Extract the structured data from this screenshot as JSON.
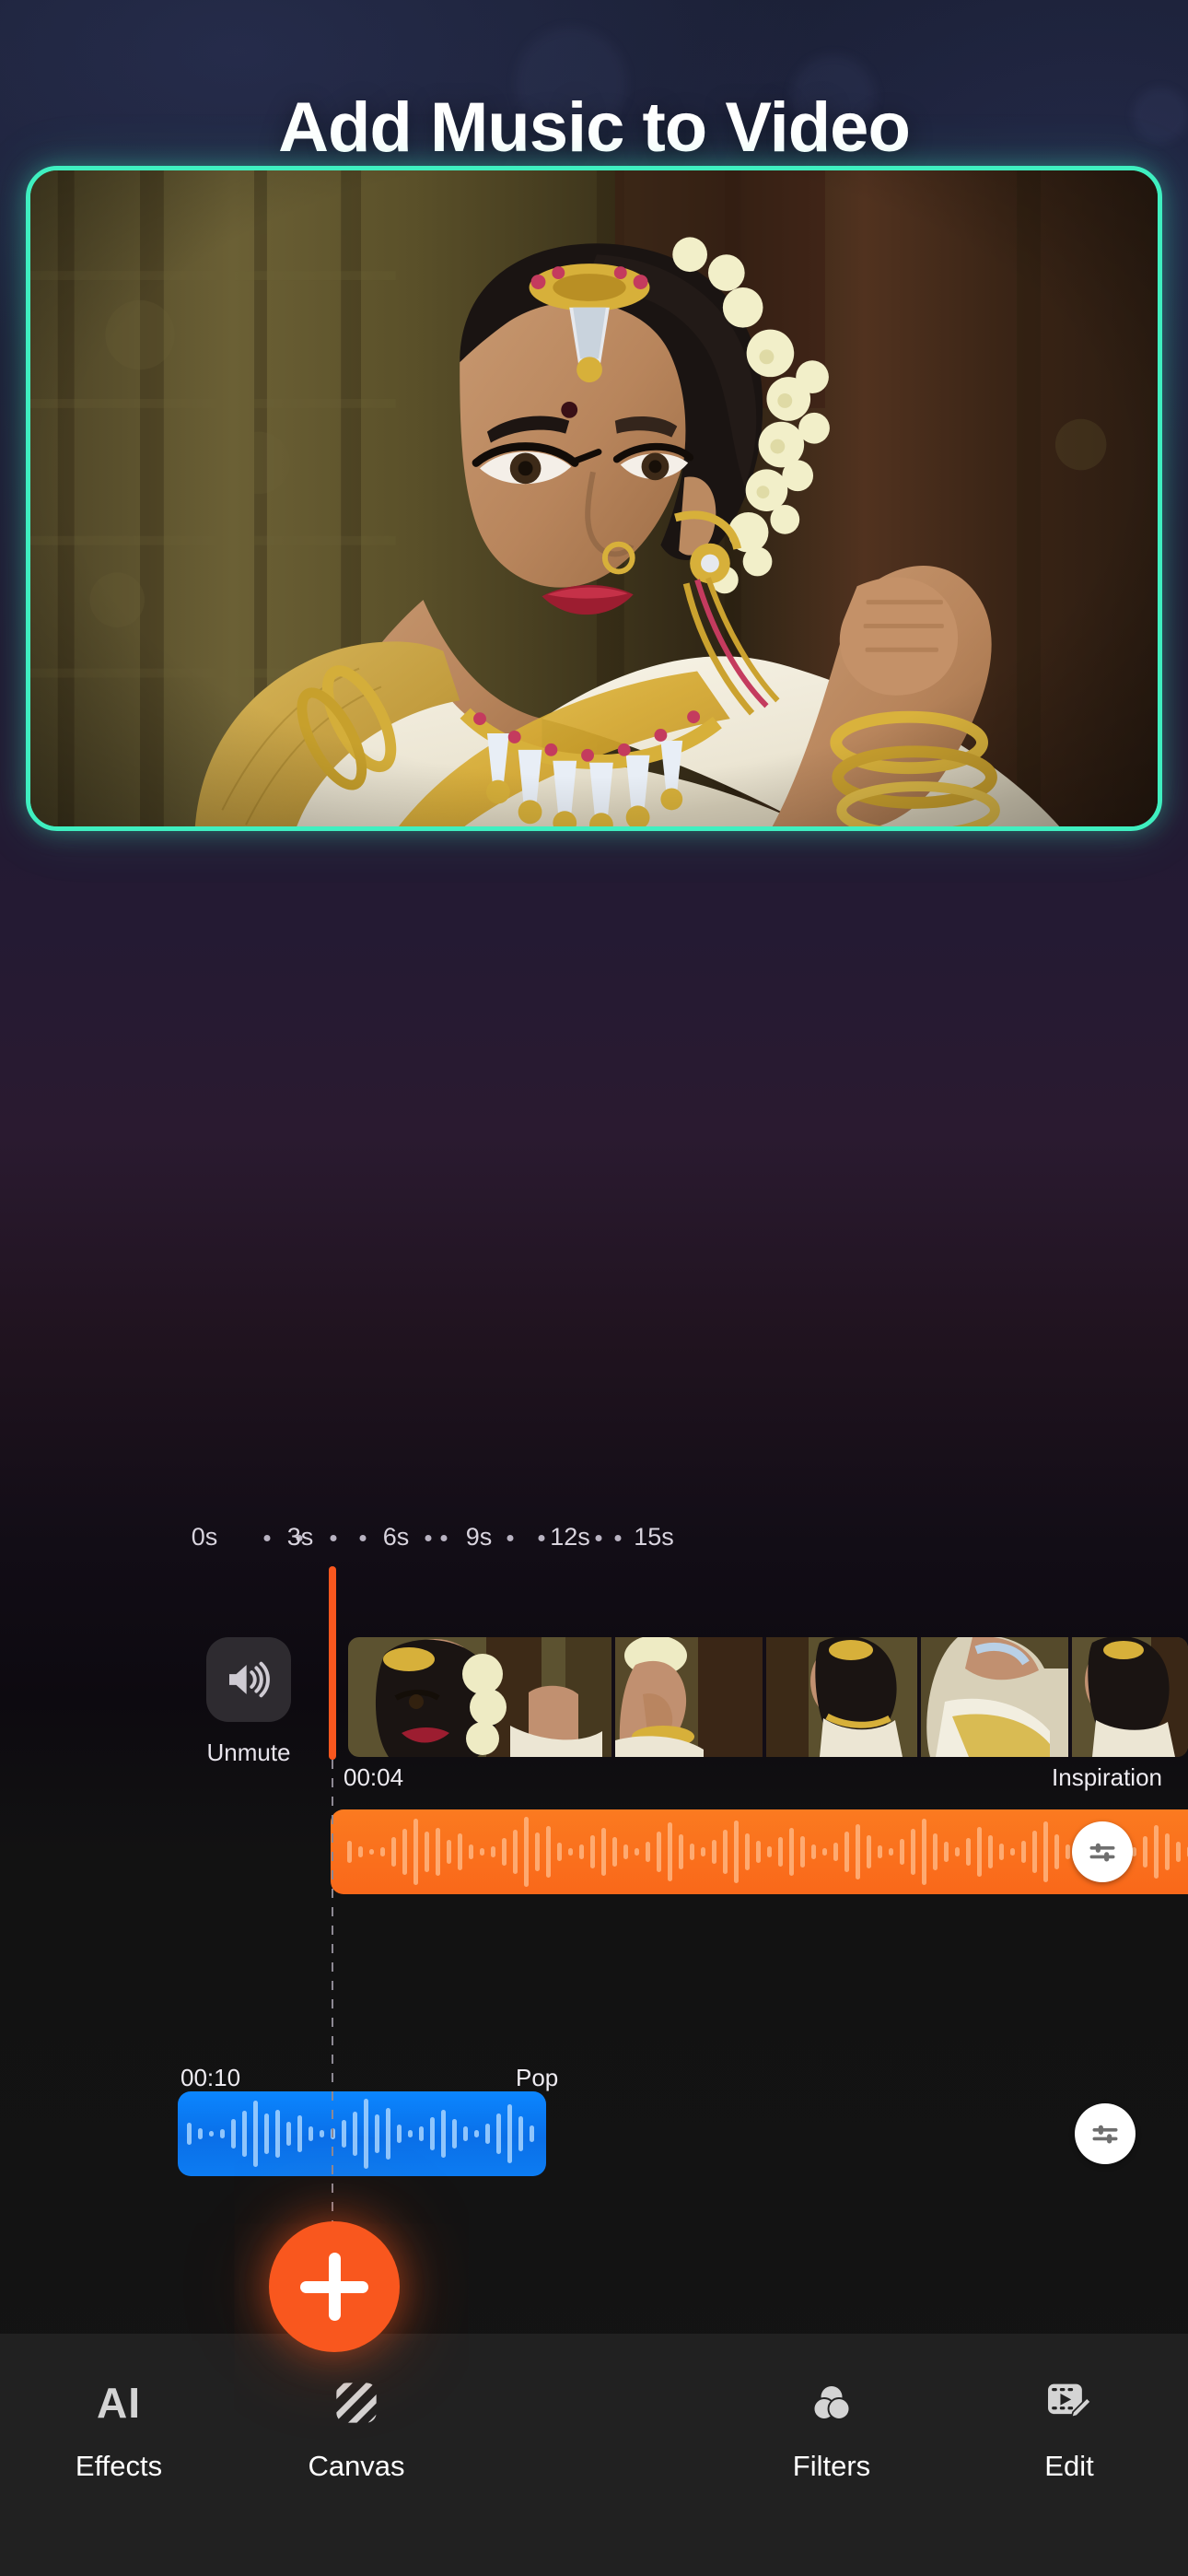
{
  "page": {
    "title": "Add Music to Video",
    "accent_teal": "#3fefc0",
    "accent_orange": "#f9571e",
    "accent_blue": "#0b86ff",
    "background": "#120d16"
  },
  "preview": {
    "name": "video-preview",
    "border_color": "#3fefc0",
    "description": "woman in white and gold saree with gold jewellery"
  },
  "timeline": {
    "ruler_labels": [
      "0s",
      "3s",
      "6s",
      "9s",
      "12s",
      "15s"
    ],
    "playhead_color": "#f9571e",
    "mute_button": {
      "label": "Unmute",
      "icon": "speaker-wave-icon"
    },
    "audio_tracks": [
      {
        "time": "00:04",
        "name": "Inspiration",
        "color": "#f9681a",
        "knob_icon": "sliders-icon"
      },
      {
        "time": "00:10",
        "name": "Pop",
        "color": "#0b86ff",
        "knob_icon": "sliders-icon"
      }
    ]
  },
  "bottom_nav": {
    "items": [
      {
        "label": "Effects",
        "icon": "ai-icon"
      },
      {
        "label": "Canvas",
        "icon": "diagonal-stripes-icon"
      },
      {
        "label": "",
        "icon": "plus-icon"
      },
      {
        "label": "Filters",
        "icon": "color-circles-icon"
      },
      {
        "label": "Edit",
        "icon": "film-pencil-icon"
      }
    ],
    "add_button": {
      "name": "add-button",
      "icon": "plus-icon",
      "color": "#f9571e"
    }
  }
}
